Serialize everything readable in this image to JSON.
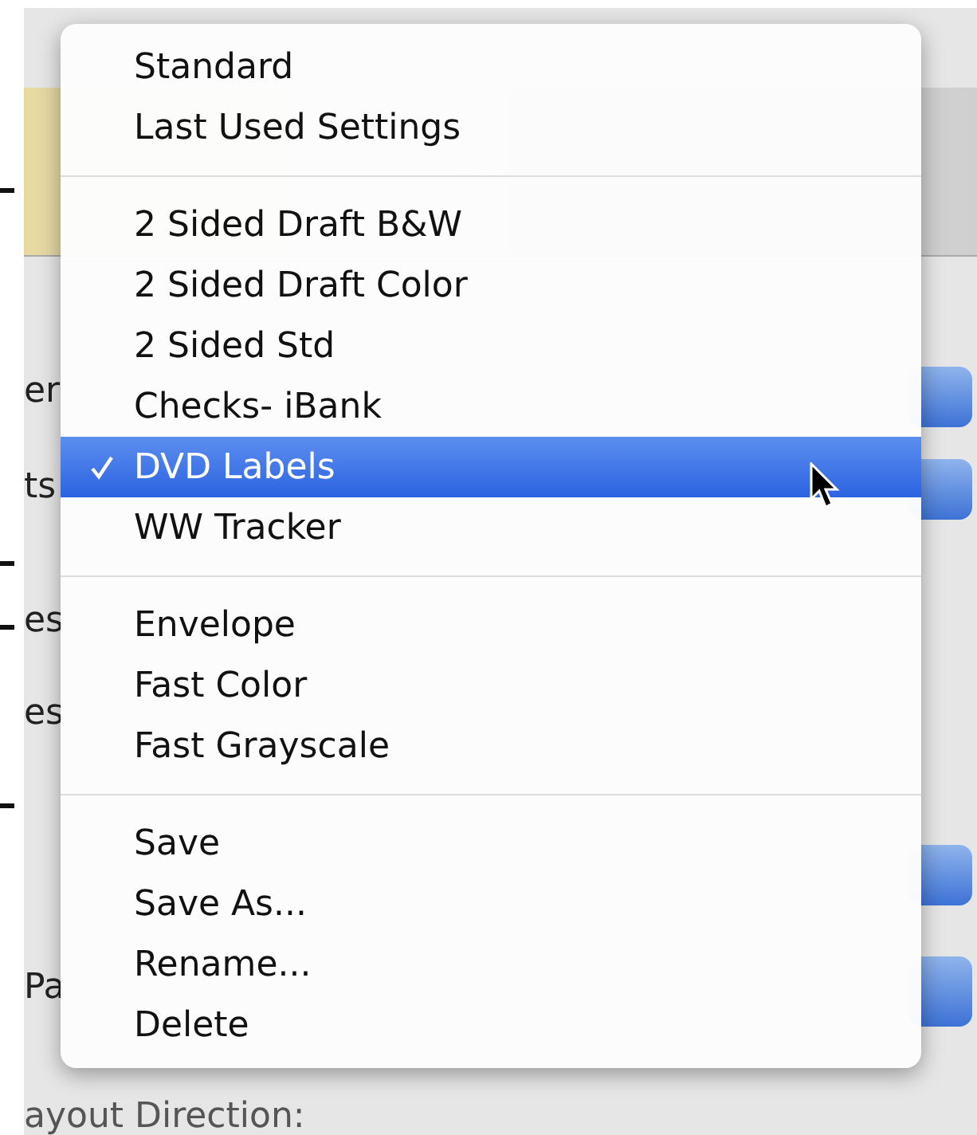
{
  "dialog": {
    "side_labels": [
      "er",
      "ts",
      "es",
      "es",
      "Pa"
    ],
    "bottom_label": "ayout Direction:"
  },
  "menu": {
    "groups": [
      [
        {
          "label": "Standard",
          "selected": false,
          "checked": false
        },
        {
          "label": "Last Used Settings",
          "selected": false,
          "checked": false
        }
      ],
      [
        {
          "label": "2 Sided Draft B&W",
          "selected": false,
          "checked": false
        },
        {
          "label": "2 Sided Draft Color",
          "selected": false,
          "checked": false
        },
        {
          "label": "2 Sided Std",
          "selected": false,
          "checked": false
        },
        {
          "label": "Checks- iBank",
          "selected": false,
          "checked": false
        },
        {
          "label": "DVD Labels",
          "selected": true,
          "checked": true
        },
        {
          "label": "WW Tracker",
          "selected": false,
          "checked": false
        }
      ],
      [
        {
          "label": "Envelope",
          "selected": false,
          "checked": false
        },
        {
          "label": "Fast Color",
          "selected": false,
          "checked": false
        },
        {
          "label": "Fast Grayscale",
          "selected": false,
          "checked": false
        }
      ],
      [
        {
          "label": "Save",
          "selected": false,
          "checked": false
        },
        {
          "label": "Save As...",
          "selected": false,
          "checked": false
        },
        {
          "label": "Rename...",
          "selected": false,
          "checked": false
        },
        {
          "label": "Delete",
          "selected": false,
          "checked": false
        }
      ]
    ]
  }
}
